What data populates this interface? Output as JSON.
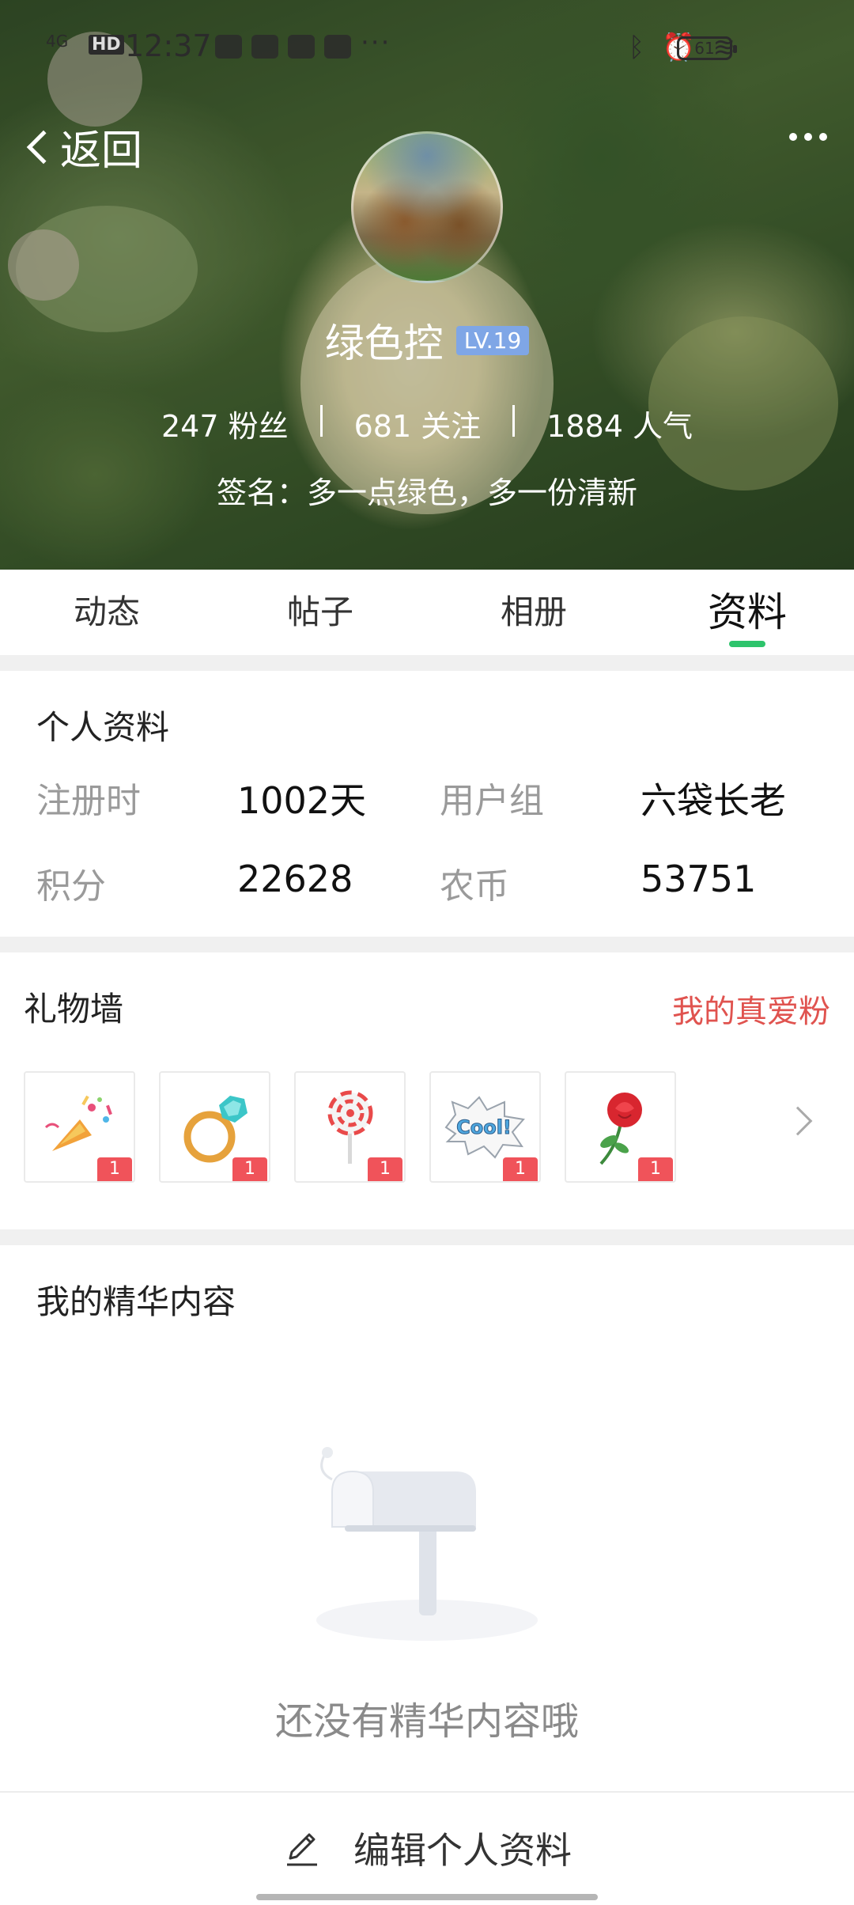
{
  "status_bar": {
    "network": "4G",
    "hd": "HD",
    "time": "12:37",
    "battery": "61"
  },
  "header": {
    "back_label": "返回",
    "username": "绿色控",
    "level": "LV.19",
    "stats": [
      {
        "value": "247 粉丝"
      },
      {
        "value": "681 关注"
      },
      {
        "value": "1884 人气"
      }
    ],
    "signature": "签名：多一点绿色，多一份清新"
  },
  "tabs": [
    {
      "label": "动态",
      "active": false
    },
    {
      "label": "帖子",
      "active": false
    },
    {
      "label": "相册",
      "active": false
    },
    {
      "label": "资料",
      "active": true
    }
  ],
  "profile": {
    "title": "个人资料",
    "fields": [
      {
        "label": "注册时",
        "value": "1002天"
      },
      {
        "label": "用户组",
        "value": "六袋长老"
      },
      {
        "label": "积分",
        "value": "22628"
      },
      {
        "label": "农币",
        "value": "53751"
      }
    ]
  },
  "gift_wall": {
    "title": "礼物墙",
    "fan_link": "我的真爱粉",
    "gifts": [
      {
        "name": "party-popper-icon",
        "count": "1"
      },
      {
        "name": "diamond-ring-icon",
        "count": "1"
      },
      {
        "name": "lollipop-icon",
        "count": "1"
      },
      {
        "name": "cool-sticker-icon",
        "count": "1"
      },
      {
        "name": "rose-icon",
        "count": "1"
      }
    ],
    "cool_text": "Cool!"
  },
  "featured": {
    "title": "我的精华内容",
    "empty_text": "还没有精华内容哦"
  },
  "bottom": {
    "edit_label": "编辑个人资料"
  },
  "colors": {
    "accent_green": "#2ec46c",
    "level_badge": "#7fa6e6",
    "fan_link_red": "#e0534f",
    "gift_count_badge": "#f0535a"
  }
}
